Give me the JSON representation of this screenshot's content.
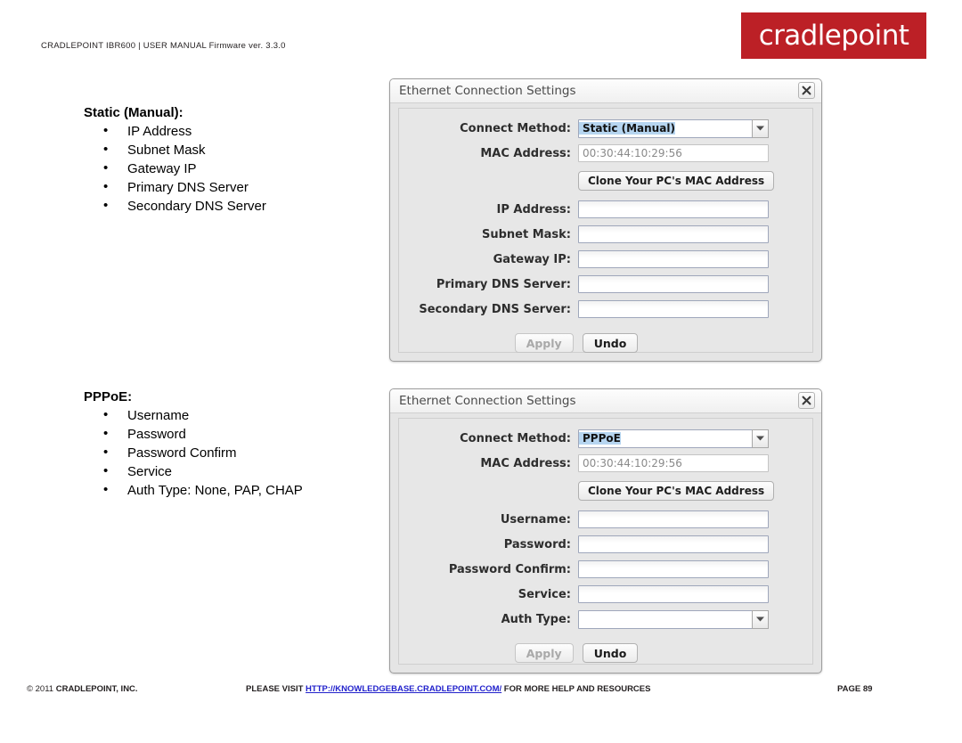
{
  "header": {
    "manual_meta": "CRADLEPOINT IBR600 | USER MANUAL Firmware ver. 3.3.0",
    "brand": "cradlepoint",
    "brand_color": "#bc2026"
  },
  "sections": [
    {
      "title": "Static (Manual):",
      "items": [
        "IP Address",
        "Subnet Mask",
        "Gateway IP",
        "Primary DNS Server",
        "Secondary DNS Server"
      ]
    },
    {
      "title": "PPPoE:",
      "items": [
        "Username",
        "Password",
        "Password Confirm",
        "Service",
        "Auth Type: None, PAP, CHAP"
      ]
    }
  ],
  "dialogs": [
    {
      "title": "Ethernet Connection Settings",
      "close_icon": "close-x-icon",
      "connect_method_label": "Connect Method:",
      "connect_method_value": "Static (Manual)",
      "mac_label": "MAC Address:",
      "mac_value": "00:30:44:10:29:56",
      "clone_button": "Clone Your PC's MAC Address",
      "fields": [
        {
          "label": "IP Address:",
          "value": ""
        },
        {
          "label": "Subnet Mask:",
          "value": ""
        },
        {
          "label": "Gateway IP:",
          "value": ""
        },
        {
          "label": "Primary DNS Server:",
          "value": ""
        },
        {
          "label": "Secondary DNS Server:",
          "value": ""
        }
      ],
      "apply_label": "Apply",
      "undo_label": "Undo"
    },
    {
      "title": "Ethernet Connection Settings",
      "close_icon": "close-x-icon",
      "connect_method_label": "Connect Method:",
      "connect_method_value": "PPPoE",
      "mac_label": "MAC Address:",
      "mac_value": "00:30:44:10:29:56",
      "clone_button": "Clone Your PC's MAC Address",
      "fields": [
        {
          "label": "Username:",
          "value": ""
        },
        {
          "label": "Password:",
          "value": ""
        },
        {
          "label": "Password Confirm:",
          "value": ""
        },
        {
          "label": "Service:",
          "value": ""
        }
      ],
      "auth_type_label": "Auth Type:",
      "auth_type_value": "",
      "apply_label": "Apply",
      "undo_label": "Undo"
    }
  ],
  "footer": {
    "copyright_symbol": "© 2011 ",
    "copyright_company": "CRADLEPOINT, INC.",
    "center_prefix": "PLEASE VISIT ",
    "center_link": "HTTP://KNOWLEDGEBASE.CRADLEPOINT.COM/",
    "center_suffix": " FOR MORE HELP AND RESOURCES",
    "page": "PAGE 89"
  }
}
